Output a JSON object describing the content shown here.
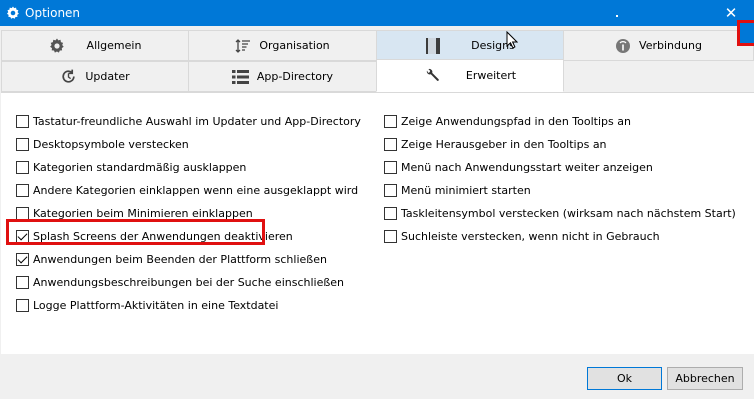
{
  "window": {
    "title": "Optionen",
    "close_glyph": "✕"
  },
  "tabs_row1": [
    {
      "label": "Allgemein",
      "icon": "gear-icon"
    },
    {
      "label": "Organisation",
      "icon": "sort-icon"
    },
    {
      "label": "Designs",
      "icon": "design-icon"
    },
    {
      "label": "Verbindung",
      "icon": "connection-icon"
    }
  ],
  "tabs_row2": [
    {
      "label": "Updater",
      "icon": "refresh-icon"
    },
    {
      "label": "App-Directory",
      "icon": "list-icon"
    },
    {
      "label": "Erweitert",
      "icon": "wrench-icon"
    }
  ],
  "options_left": [
    {
      "label": "Tastatur-freundliche Auswahl im Updater und App-Directory",
      "checked": false
    },
    {
      "label": "Desktopsymbole verstecken",
      "checked": false
    },
    {
      "label": "Kategorien standardmäßig ausklappen",
      "checked": false
    },
    {
      "label": "Andere Kategorien einklappen wenn eine ausgeklappt wird",
      "checked": false
    },
    {
      "label": "Kategorien beim Minimieren einklappen",
      "checked": false
    },
    {
      "label": "Splash Screens der Anwendungen deaktivieren",
      "checked": true
    },
    {
      "label": "Anwendungen beim Beenden der Plattform schließen",
      "checked": true
    },
    {
      "label": "Anwendungsbeschreibungen bei der Suche einschließen",
      "checked": false
    },
    {
      "label": "Logge Plattform-Aktivitäten in eine Textdatei",
      "checked": false
    }
  ],
  "options_right": [
    {
      "label": "Zeige Anwendungspfad in den Tooltips an",
      "checked": false
    },
    {
      "label": "Zeige Herausgeber in den Tooltips an",
      "checked": false
    },
    {
      "label": "Menü nach Anwendungsstart weiter anzeigen",
      "checked": false
    },
    {
      "label": "Menü minimiert starten",
      "checked": false
    },
    {
      "label": "Taskleitensymbol verstecken (wirksam nach nächstem Start)",
      "checked": false
    },
    {
      "label": "Suchleiste verstecken, wenn nicht in Gebrauch",
      "checked": false
    }
  ],
  "buttons": {
    "ok": "Ok",
    "cancel": "Abbrechen"
  },
  "colors": {
    "titlebar": "#0078d7",
    "highlight": "#e01010",
    "tab_hover": "#d8e6f2"
  }
}
